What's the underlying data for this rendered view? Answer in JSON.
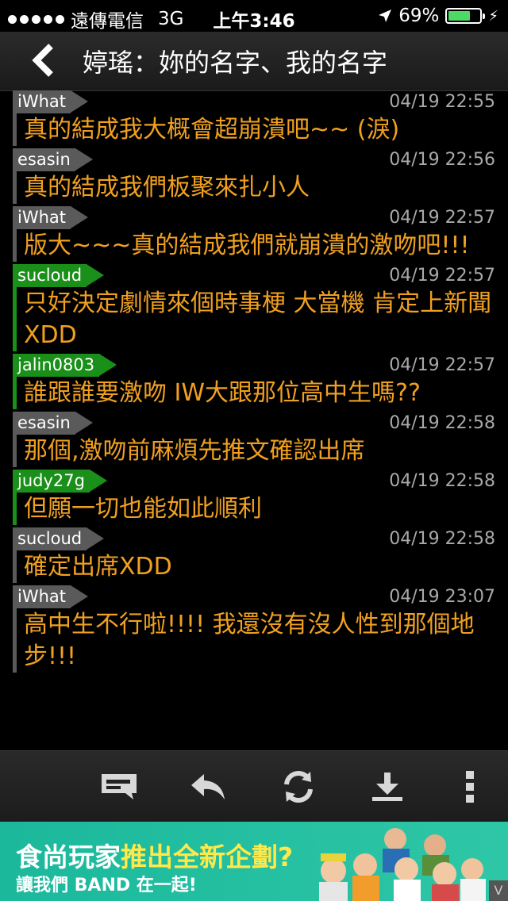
{
  "status_bar": {
    "carrier": "遠傳電信",
    "network": "3G",
    "time": "上午3:46",
    "battery_percent": "69%",
    "battery_level": 0.69
  },
  "header": {
    "title": "婷瑤：妳的名字、我的名字"
  },
  "comments": [
    {
      "author": "iWhat",
      "time": "04/19 22:55",
      "text": "真的結成我大概會超崩潰吧~~ (淚)",
      "tag_color": "#5a5a5a"
    },
    {
      "author": "esasin",
      "time": "04/19 22:56",
      "text": "真的結成我們板聚來扎小人",
      "tag_color": "#5a5a5a"
    },
    {
      "author": "iWhat",
      "time": "04/19 22:57",
      "text": "版大~~~真的結成我們就崩潰的激吻吧!!!",
      "tag_color": "#5a5a5a"
    },
    {
      "author": "sucloud",
      "time": "04/19 22:57",
      "text": "只好決定劇情來個時事梗 大當機 肯定上新聞XDD",
      "tag_color": "#1a8f1a"
    },
    {
      "author": "jalin0803",
      "time": "04/19 22:57",
      "text": "誰跟誰要激吻  IW大跟那位高中生嗎??",
      "tag_color": "#1a8f1a"
    },
    {
      "author": "esasin",
      "time": "04/19 22:58",
      "text": "那個,激吻前麻煩先推文確認出席",
      "tag_color": "#5a5a5a"
    },
    {
      "author": "judy27g",
      "time": "04/19 22:58",
      "text": "但願一切也能如此順利",
      "tag_color": "#1a8f1a"
    },
    {
      "author": "sucloud",
      "time": "04/19 22:58",
      "text": "確定出席XDD",
      "tag_color": "#5a5a5a"
    },
    {
      "author": "iWhat",
      "time": "04/19 23:07",
      "text": "高中生不行啦!!!!  我還沒有沒人性到那個地步!!!",
      "tag_color": "#5a5a5a"
    }
  ],
  "toolbar": {
    "icons": [
      "comment-icon",
      "reply-icon",
      "refresh-icon",
      "download-icon",
      "more-icon"
    ]
  },
  "ad": {
    "title_part1": "食尚玩家",
    "title_part2": "推出全新企劃?",
    "subtitle": "讓我們 BAND 在一起!",
    "badge": "V"
  }
}
